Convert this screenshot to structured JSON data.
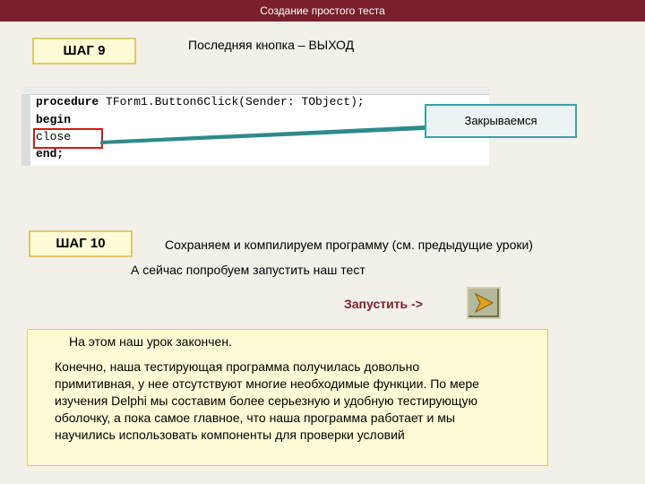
{
  "title": "Создание простого теста",
  "step9": {
    "label": "ШАГ 9",
    "heading": "Последняя кнопка – ВЫХОД",
    "code": {
      "line1_keyword": "procedure",
      "line1_rest": " TForm1.Button6Click(Sender: TObject);",
      "line2": "begin",
      "line3": "close",
      "line4": "end;"
    },
    "callout": "Закрываемся"
  },
  "step10": {
    "label": "ШАГ 10",
    "heading": "Сохраняем и компилируем программу (см. предыдущие уроки)",
    "subtext": "А сейчас попробуем запустить наш тест",
    "run_label": "Запустить ->"
  },
  "note": {
    "line1": "На этом наш урок закончен.",
    "paragraph_lines": [
      "Конечно, наша тестирующая программа получилась довольно",
      "примитивная, у нее отсутствуют многие необходимые функции. По мере",
      "изучения Delphi мы составим более серьезную и удобную тестирующую",
      "оболочку, а пока самое главное, что наша программа работает и мы",
      "научились использовать компоненты для проверки условий"
    ]
  },
  "colors": {
    "titlebar": "#7a1f2b",
    "step_box_fill": "#fffbd6",
    "step_box_border": "#e0c86a",
    "highlight": "#d21a1a",
    "connector": "#2f8a8a"
  },
  "icons": {
    "run": "play-arrow-icon"
  }
}
